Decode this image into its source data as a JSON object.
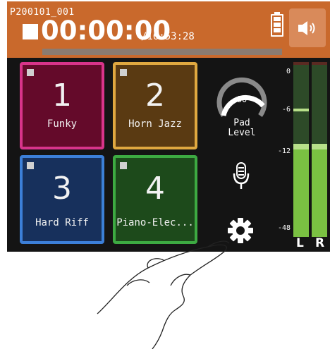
{
  "header": {
    "project_name": "P200101_001",
    "timecode": "00:00:00",
    "remaining": "/16:53:28",
    "progress_fraction": 0,
    "battery_icon": "battery-full-icon",
    "speaker_icon": "speaker-icon"
  },
  "pads": [
    {
      "number": "1",
      "name": "Funky"
    },
    {
      "number": "2",
      "name": "Horn Jazz"
    },
    {
      "number": "3",
      "name": "Hard Riff"
    },
    {
      "number": "4",
      "name": "Piano-Elec..."
    }
  ],
  "pad_level": {
    "value": "80",
    "label_line1": "Pad",
    "label_line2": "Level"
  },
  "icons": {
    "mic": "microphone-icon",
    "settings": "gear-icon"
  },
  "meters": {
    "scale": [
      "0",
      "-6",
      "-12",
      "-48"
    ],
    "channels": [
      {
        "label": "L",
        "level_db": -13,
        "peak_db": -6
      },
      {
        "label": "R",
        "level_db": -13,
        "peak_db": -12
      }
    ]
  },
  "colors": {
    "header": "#c9692c",
    "pad1": "#d8348a",
    "pad2": "#e0a840",
    "pad3": "#3c7fd8",
    "pad4": "#3daa42",
    "meter": "#7ac142"
  }
}
